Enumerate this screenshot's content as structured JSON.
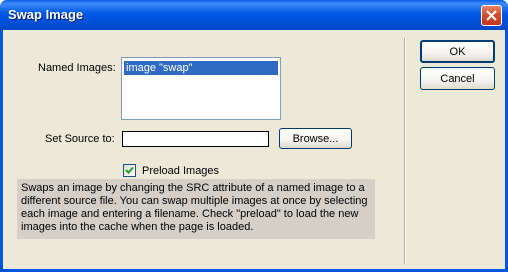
{
  "window": {
    "title": "Swap Image"
  },
  "form": {
    "named_images_label": "Named Images:",
    "named_images": [
      "image \"swap\""
    ],
    "set_source_label": "Set Source to:",
    "source_value": "",
    "browse_label": "Browse...",
    "preload_label": "Preload Images",
    "preload_checked": true,
    "description": "Swaps an image by changing the SRC attribute of a named image to a different source file. You can swap multiple images at once by selecting each image and entering a filename. Check \"preload\" to load the new images into the cache when the page is loaded."
  },
  "buttons": {
    "ok": "OK",
    "cancel": "Cancel"
  },
  "colors": {
    "titlebar": "#0054e3",
    "selection": "#316ac5",
    "dialog_bg": "#ece9d8",
    "help_bg": "#d4d0c8"
  }
}
